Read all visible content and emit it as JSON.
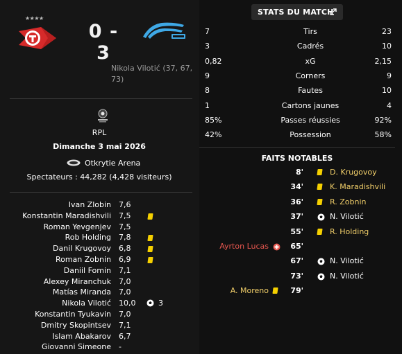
{
  "match": {
    "score": "0 - 3",
    "home_stars": "★★★★",
    "scorers": "Nikola Vilotić (37, 67, 73)",
    "competition": "RPL",
    "date": "Dimanche 3 mai 2026",
    "stadium": "Otkrytie Arena",
    "attendance": "Spectateurs : 44,282 (4,428 visiteurs)"
  },
  "players": [
    {
      "name": "Ivan Zlobin",
      "rating": "7,6",
      "yellow": false,
      "goals": ""
    },
    {
      "name": "Konstantin Maradishvili",
      "rating": "7,5",
      "yellow": true,
      "goals": ""
    },
    {
      "name": "Roman Yevgenjev",
      "rating": "7,5",
      "yellow": false,
      "goals": ""
    },
    {
      "name": "Rob Holding",
      "rating": "7,8",
      "yellow": true,
      "goals": ""
    },
    {
      "name": "Danil Krugovoy",
      "rating": "6,8",
      "yellow": true,
      "goals": ""
    },
    {
      "name": "Roman Zobnin",
      "rating": "6,9",
      "yellow": true,
      "goals": ""
    },
    {
      "name": "Daniil Fomin",
      "rating": "7,1",
      "yellow": false,
      "goals": ""
    },
    {
      "name": "Alexey Miranchuk",
      "rating": "7,0",
      "yellow": false,
      "goals": ""
    },
    {
      "name": "Matías Miranda",
      "rating": "7,0",
      "yellow": false,
      "goals": ""
    },
    {
      "name": "Nikola Vilotić",
      "rating": "10,0",
      "yellow": false,
      "goals": "3"
    },
    {
      "name": "Konstantin Tyukavin",
      "rating": "7,0",
      "yellow": false,
      "goals": ""
    },
    {
      "name": "Dmitry Skopintsev",
      "rating": "7,1",
      "yellow": false,
      "goals": ""
    },
    {
      "name": "Islam Abakarov",
      "rating": "6,7",
      "yellow": false,
      "goals": ""
    },
    {
      "name": "Giovanni Simeone",
      "rating": "-",
      "yellow": false,
      "goals": ""
    }
  ],
  "stats_panel": {
    "title": "STATS DU MATCH",
    "rows": [
      {
        "home": "7",
        "label": "Tirs",
        "away": "23"
      },
      {
        "home": "3",
        "label": "Cadrés",
        "away": "10"
      },
      {
        "home": "0,82",
        "label": "xG",
        "away": "2,15"
      },
      {
        "home": "9",
        "label": "Corners",
        "away": "9"
      },
      {
        "home": "8",
        "label": "Fautes",
        "away": "10"
      },
      {
        "home": "1",
        "label": "Cartons jaunes",
        "away": "4"
      },
      {
        "home": "85%",
        "label": "Passes réussies",
        "away": "92%"
      },
      {
        "home": "42%",
        "label": "Possession",
        "away": "58%"
      }
    ]
  },
  "events": {
    "title": "FAITS NOTABLES",
    "items": [
      {
        "minute": "8'",
        "side": "away",
        "type": "yellow",
        "player": "D. Krugovoy"
      },
      {
        "minute": "34'",
        "side": "away",
        "type": "yellow",
        "player": "K. Maradishvili"
      },
      {
        "minute": "36'",
        "side": "away",
        "type": "yellow",
        "player": "R. Zobnin"
      },
      {
        "minute": "37'",
        "side": "away",
        "type": "goal",
        "player": "N. Vilotić"
      },
      {
        "minute": "55'",
        "side": "away",
        "type": "yellow",
        "player": "R. Holding"
      },
      {
        "minute": "65'",
        "side": "home",
        "type": "injury",
        "player": "Ayrton Lucas"
      },
      {
        "minute": "67'",
        "side": "away",
        "type": "goal",
        "player": "N. Vilotić"
      },
      {
        "minute": "73'",
        "side": "away",
        "type": "goal",
        "player": "N. Vilotić"
      },
      {
        "minute": "79'",
        "side": "home",
        "type": "yellow",
        "player": "A. Moreno"
      }
    ]
  },
  "colors": {
    "yellow_card": "#f5d000",
    "yellow_text": "#f3d06a",
    "injury_red": "#e8574f",
    "spartak_red": "#d62a2a",
    "zenit_blue": "#3fa9e6"
  }
}
